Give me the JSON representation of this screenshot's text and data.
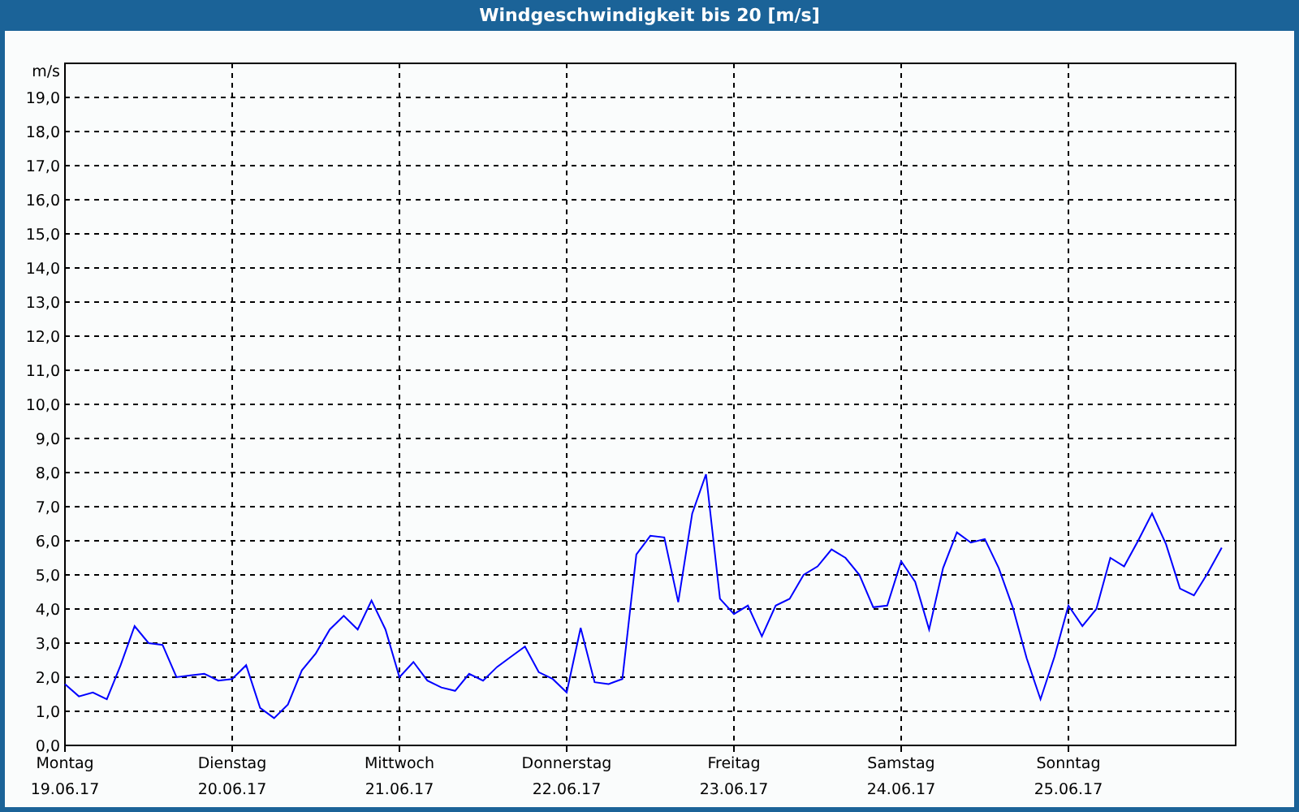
{
  "window": {
    "title": "Windgeschwindigkeit bis 20 [m/s]"
  },
  "chart": {
    "chart_data": {
      "type": "line",
      "grid": true,
      "ylabel": "m/s",
      "ylim": [
        0,
        20
      ],
      "yticks": [
        {
          "value": 0,
          "label": "0,0"
        },
        {
          "value": 1,
          "label": "1,0"
        },
        {
          "value": 2,
          "label": "2,0"
        },
        {
          "value": 3,
          "label": "3,0"
        },
        {
          "value": 4,
          "label": "4,0"
        },
        {
          "value": 5,
          "label": "5,0"
        },
        {
          "value": 6,
          "label": "6,0"
        },
        {
          "value": 7,
          "label": "7,0"
        },
        {
          "value": 8,
          "label": "8,0"
        },
        {
          "value": 9,
          "label": "9,0"
        },
        {
          "value": 10,
          "label": "10,0"
        },
        {
          "value": 11,
          "label": "11,0"
        },
        {
          "value": 12,
          "label": "12,0"
        },
        {
          "value": 13,
          "label": "13,0"
        },
        {
          "value": 14,
          "label": "14,0"
        },
        {
          "value": 15,
          "label": "15,0"
        },
        {
          "value": 16,
          "label": "16,0"
        },
        {
          "value": 17,
          "label": "17,0"
        },
        {
          "value": 18,
          "label": "18,0"
        },
        {
          "value": 19,
          "label": "19,0"
        }
      ],
      "categories": [
        "Montag\n19.06.17",
        null,
        null,
        null,
        null,
        null,
        null,
        null,
        null,
        null,
        null,
        null,
        "Dienstag\n20.06.17",
        null,
        null,
        null,
        null,
        null,
        null,
        null,
        null,
        null,
        null,
        null,
        "Mittwoch\n21.06.17",
        null,
        null,
        null,
        null,
        null,
        null,
        null,
        null,
        null,
        null,
        null,
        "Donnerstag\n22.06.17",
        null,
        null,
        null,
        null,
        null,
        null,
        null,
        null,
        null,
        null,
        null,
        "Freitag\n23.06.17",
        null,
        null,
        null,
        null,
        null,
        null,
        null,
        null,
        null,
        null,
        null,
        "Samstag\n24.06.17",
        null,
        null,
        null,
        null,
        null,
        null,
        null,
        null,
        null,
        null,
        null,
        "Sonntag\n25.06.17",
        null,
        null,
        null,
        null,
        null,
        null,
        null,
        null,
        null,
        null,
        null
      ],
      "series": [
        {
          "color": "#0000ff",
          "values": [
            1.8,
            1.44,
            1.55,
            1.35,
            2.35,
            3.5,
            3.0,
            2.95,
            2.0,
            2.05,
            2.1,
            1.9,
            1.95,
            2.35,
            1.1,
            0.8,
            1.2,
            2.2,
            2.7,
            3.4,
            3.8,
            3.4,
            4.25,
            3.4,
            2.0,
            2.45,
            1.9,
            1.7,
            1.6,
            2.1,
            1.9,
            2.3,
            2.6,
            2.9,
            2.15,
            1.95,
            1.55,
            3.45,
            1.85,
            1.8,
            1.95,
            5.6,
            6.15,
            6.1,
            4.2,
            6.8,
            7.95,
            4.3,
            3.85,
            4.1,
            3.2,
            4.1,
            4.3,
            5.0,
            5.25,
            5.75,
            5.5,
            5.0,
            4.05,
            4.1,
            5.4,
            4.8,
            3.4,
            5.2,
            6.25,
            5.95,
            6.05,
            5.2,
            4.05,
            2.55,
            1.35,
            2.6,
            4.1,
            3.5,
            4.0,
            5.5,
            5.25,
            6.0,
            6.8,
            5.9,
            4.6,
            4.4,
            5.05,
            5.8
          ]
        }
      ]
    }
  }
}
